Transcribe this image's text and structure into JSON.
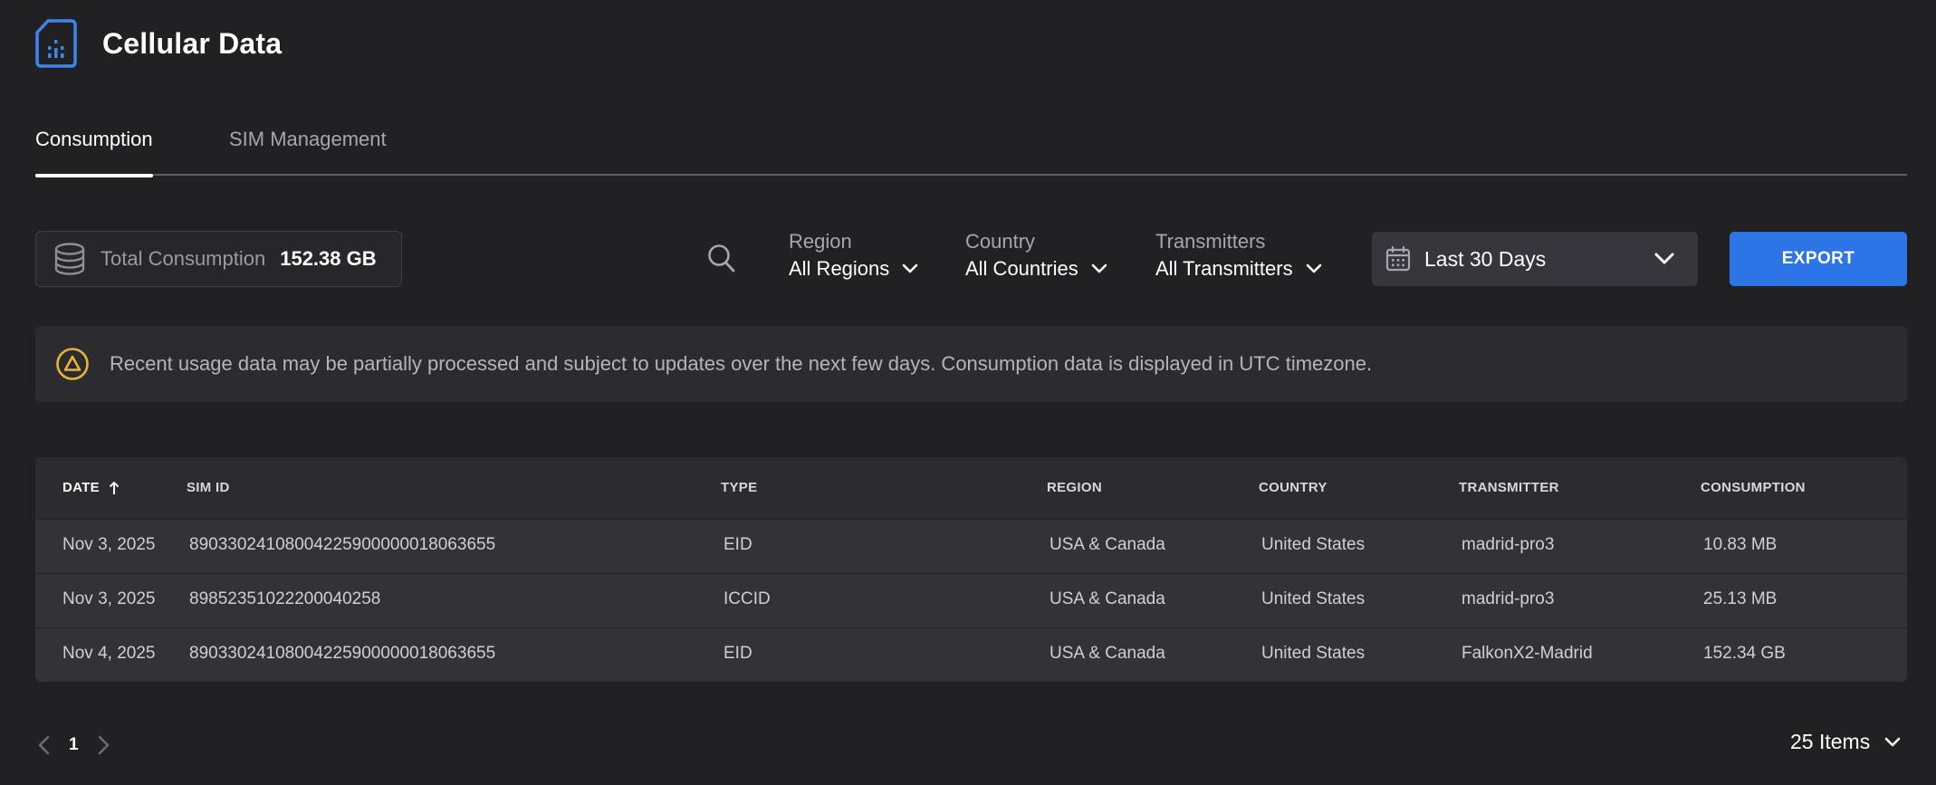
{
  "app": {
    "title": "Cellular Data",
    "icon": "sim-card-icon"
  },
  "tabs": [
    {
      "label": "Consumption",
      "active": true
    },
    {
      "label": "SIM Management",
      "active": false
    }
  ],
  "toolbar": {
    "total_label": "Total Consumption",
    "total_value": "152.38 GB",
    "filters": {
      "region": {
        "label": "Region",
        "value": "All Regions"
      },
      "country": {
        "label": "Country",
        "value": "All Countries"
      },
      "transmitters": {
        "label": "Transmitters",
        "value": "All Transmitters"
      }
    },
    "date_range": "Last 30 Days",
    "export_label": "EXPORT"
  },
  "notice": {
    "text": "Recent usage data may be partially processed and subject to updates over the next few days. Consumption data is displayed in UTC timezone."
  },
  "table": {
    "columns": [
      "DATE",
      "SIM ID",
      "TYPE",
      "REGION",
      "COUNTRY",
      "TRANSMITTER",
      "CONSUMPTION"
    ],
    "sort": {
      "column": "DATE",
      "direction": "ascending"
    },
    "rows": [
      [
        "Nov 3, 2025",
        "89033024108004225900000018063655",
        "EID",
        "USA & Canada",
        "United States",
        "madrid-pro3",
        "10.83 MB"
      ],
      [
        "Nov 3, 2025",
        "89852351022200040258",
        "ICCID",
        "USA & Canada",
        "United States",
        "madrid-pro3",
        "25.13 MB"
      ],
      [
        "Nov 4, 2025",
        "89033024108004225900000018063655",
        "EID",
        "USA & Canada",
        "United States",
        "FalkonX2-Madrid",
        "152.34 GB"
      ]
    ]
  },
  "pagination": {
    "current_page": "1",
    "items_per_page": "25 Items"
  },
  "colors": {
    "accent": "#2d74e6",
    "warning": "#e8b339",
    "background": "#212124"
  }
}
